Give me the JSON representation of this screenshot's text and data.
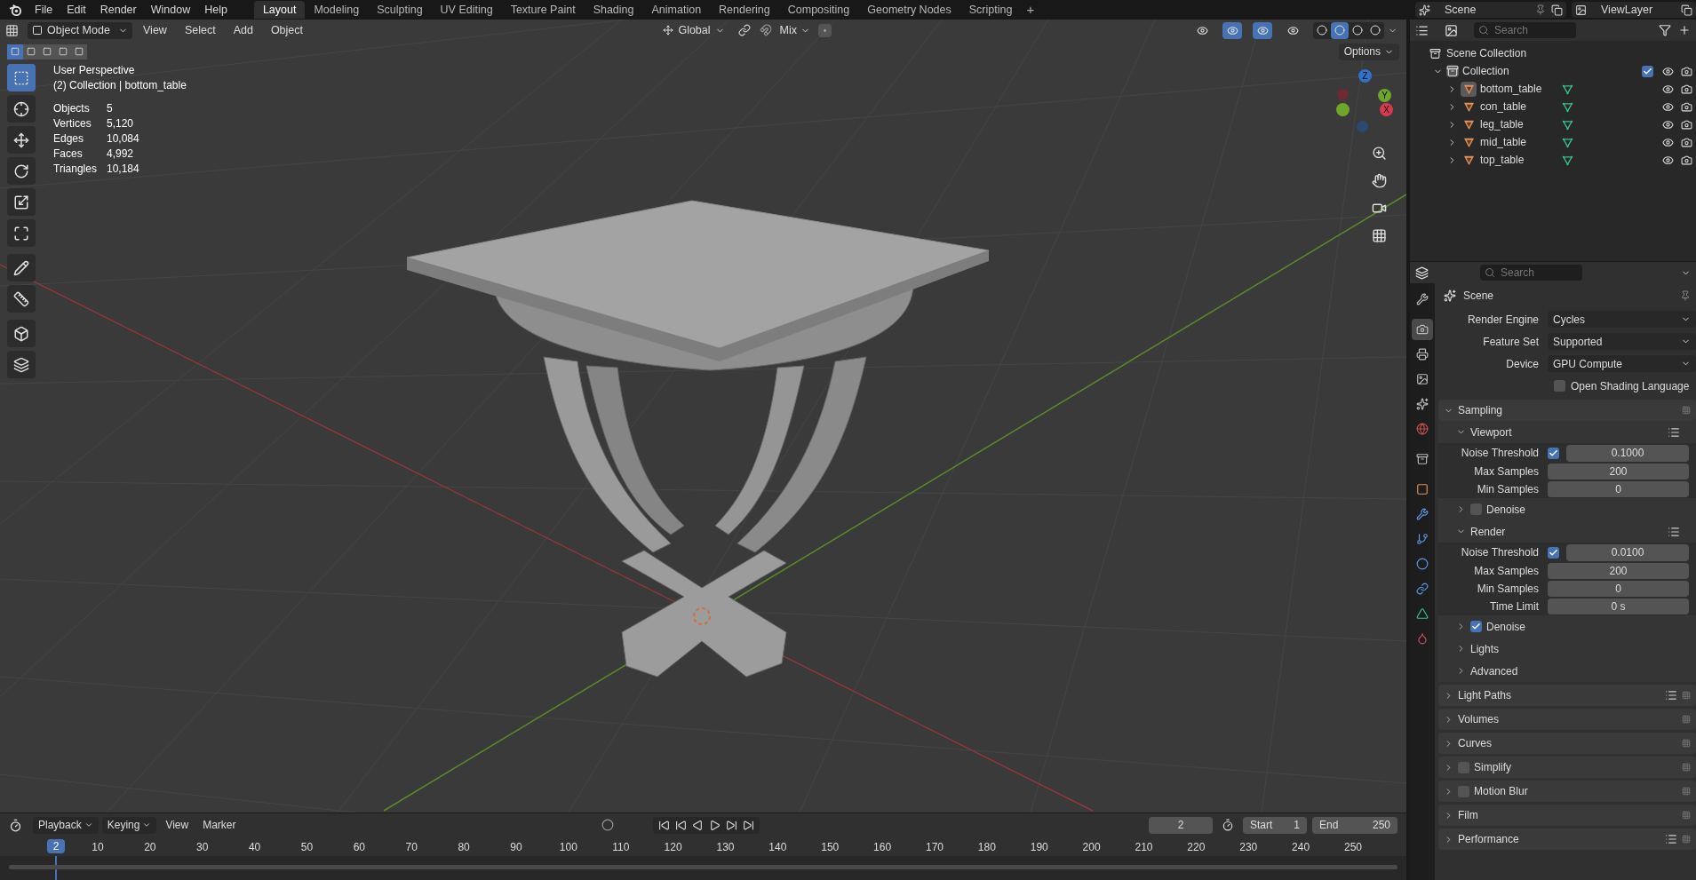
{
  "menu": [
    "File",
    "Edit",
    "Render",
    "Window",
    "Help"
  ],
  "workspaces": [
    {
      "label": "Layout",
      "selected": true
    },
    {
      "label": "Modeling",
      "selected": false
    },
    {
      "label": "Sculpting",
      "selected": false
    },
    {
      "label": "UV Editing",
      "selected": false
    },
    {
      "label": "Texture Paint",
      "selected": false
    },
    {
      "label": "Shading",
      "selected": false
    },
    {
      "label": "Animation",
      "selected": false
    },
    {
      "label": "Rendering",
      "selected": false
    },
    {
      "label": "Compositing",
      "selected": false
    },
    {
      "label": "Geometry Nodes",
      "selected": false
    },
    {
      "label": "Scripting",
      "selected": false
    }
  ],
  "add_workspace": "+",
  "scene": "Scene",
  "view_layer": "ViewLayer",
  "viewport": {
    "mode": "Object Mode",
    "menus": [
      "View",
      "Select",
      "Add",
      "Object"
    ],
    "orientation": "Global",
    "snap_target": "Mix",
    "options": "Options",
    "select_modes": [
      {
        "selected": true
      },
      {
        "selected": false
      },
      {
        "selected": false
      },
      {
        "selected": false
      },
      {
        "selected": false
      }
    ],
    "toggles": [
      {
        "on": false
      },
      {
        "on": true
      },
      {
        "on": true
      },
      {
        "on": false
      }
    ],
    "shading": [
      {
        "selected": false
      },
      {
        "selected": true
      },
      {
        "selected": false
      },
      {
        "selected": false
      }
    ],
    "tools": [
      {
        "kind": "select",
        "selected": true
      },
      {
        "kind": "cursor",
        "selected": false
      },
      {
        "kind": "move",
        "selected": false
      },
      {
        "kind": "rotate",
        "selected": false
      },
      {
        "kind": "scale",
        "selected": false
      },
      {
        "kind": "transform",
        "selected": false
      },
      {
        "kind": "annotate",
        "selected": false
      },
      {
        "kind": "measure",
        "selected": false
      },
      {
        "kind": "add_cube",
        "selected": false
      },
      {
        "kind": "extrude",
        "selected": false
      }
    ],
    "title": "User Perspective",
    "subtitle": "(2) Collection | bottom_table",
    "stats": [
      {
        "label": "Objects",
        "value": "5"
      },
      {
        "label": "Vertices",
        "value": "5,120"
      },
      {
        "label": "Edges",
        "value": "10,084"
      },
      {
        "label": "Faces",
        "value": "4,992"
      },
      {
        "label": "Triangles",
        "value": "10,184"
      }
    ],
    "gizmo": {
      "z": "Z",
      "y": "Y",
      "x": "X"
    }
  },
  "outliner": {
    "search_placeholder": "Search",
    "root": "Scene Collection",
    "collection": {
      "name": "Collection",
      "expanded": true,
      "checked": true,
      "children": [
        {
          "name": "bottom_table",
          "active": true
        },
        {
          "name": "con_table",
          "active": false
        },
        {
          "name": "leg_table",
          "active": false
        },
        {
          "name": "mid_table",
          "active": false
        },
        {
          "name": "top_table",
          "active": false
        }
      ]
    }
  },
  "properties": {
    "search_placeholder": "Search",
    "context": "Scene",
    "tabs": [
      {
        "kind": "tool",
        "selected": false
      },
      {
        "kind": "render",
        "selected": true
      },
      {
        "kind": "output",
        "selected": false
      },
      {
        "kind": "view_layer",
        "selected": false
      },
      {
        "kind": "scene",
        "selected": false
      },
      {
        "kind": "world",
        "selected": false
      },
      {
        "kind": "collection",
        "selected": false
      },
      {
        "kind": "object",
        "selected": false
      },
      {
        "kind": "modifiers",
        "selected": false
      },
      {
        "kind": "particles",
        "selected": false
      },
      {
        "kind": "physics",
        "selected": false
      },
      {
        "kind": "constraints",
        "selected": false
      },
      {
        "kind": "data",
        "selected": false
      },
      {
        "kind": "material",
        "selected": false
      }
    ],
    "rows": [
      {
        "kind": "dropdown",
        "label": "Render Engine",
        "value": "Cycles"
      },
      {
        "kind": "dropdown",
        "label": "Feature Set",
        "value": "Supported"
      },
      {
        "kind": "dropdown",
        "label": "Device",
        "value": "GPU Compute"
      },
      {
        "kind": "check",
        "label": "Open Shading Language",
        "checked": false
      },
      {
        "kind": "panel",
        "label": "Sampling",
        "expanded": true
      },
      {
        "kind": "subpanel",
        "label": "Viewport",
        "expanded": true,
        "presets": true
      },
      {
        "kind": "check_number",
        "label": "Noise Threshold",
        "checked": true,
        "value": "0.1000"
      },
      {
        "kind": "number",
        "label": "Max Samples",
        "value": "200"
      },
      {
        "kind": "number",
        "label": "Min Samples",
        "value": "0"
      },
      {
        "kind": "subpanel",
        "label": "Denoise",
        "expanded": false,
        "checked": false
      },
      {
        "kind": "subpanel",
        "label": "Render",
        "expanded": true,
        "presets": true
      },
      {
        "kind": "check_number",
        "label": "Noise Threshold",
        "checked": true,
        "value": "0.0100"
      },
      {
        "kind": "number",
        "label": "Max Samples",
        "value": "200"
      },
      {
        "kind": "number",
        "label": "Min Samples",
        "value": "0"
      },
      {
        "kind": "number",
        "label": "Time Limit",
        "value": "0 s"
      },
      {
        "kind": "subpanel",
        "label": "Denoise",
        "expanded": false,
        "checked": true
      },
      {
        "kind": "subpanel",
        "label": "Lights",
        "expanded": false
      },
      {
        "kind": "subpanel",
        "label": "Advanced",
        "expanded": false
      },
      {
        "kind": "panel",
        "label": "Light Paths",
        "expanded": false,
        "presets": true
      },
      {
        "kind": "panel",
        "label": "Volumes",
        "expanded": false
      },
      {
        "kind": "panel",
        "label": "Curves",
        "expanded": false
      },
      {
        "kind": "panel",
        "label": "Simplify",
        "expanded": false,
        "checked": false
      },
      {
        "kind": "panel",
        "label": "Motion Blur",
        "expanded": false,
        "checked": false
      },
      {
        "kind": "panel",
        "label": "Film",
        "expanded": false
      },
      {
        "kind": "panel",
        "label": "Performance",
        "expanded": false,
        "presets": true
      }
    ]
  },
  "timeline": {
    "menus": [
      "Playback",
      "Keying",
      "View",
      "Marker"
    ],
    "current_frame": "2",
    "start_label": "Start",
    "start": "1",
    "end_label": "End",
    "end": "250",
    "playhead": "2",
    "ruler": [
      "10",
      "20",
      "30",
      "40",
      "50",
      "60",
      "70",
      "80",
      "90",
      "100",
      "110",
      "120",
      "130",
      "140",
      "150",
      "160",
      "170",
      "180",
      "190",
      "200",
      "210",
      "220",
      "230",
      "240",
      "250"
    ]
  }
}
